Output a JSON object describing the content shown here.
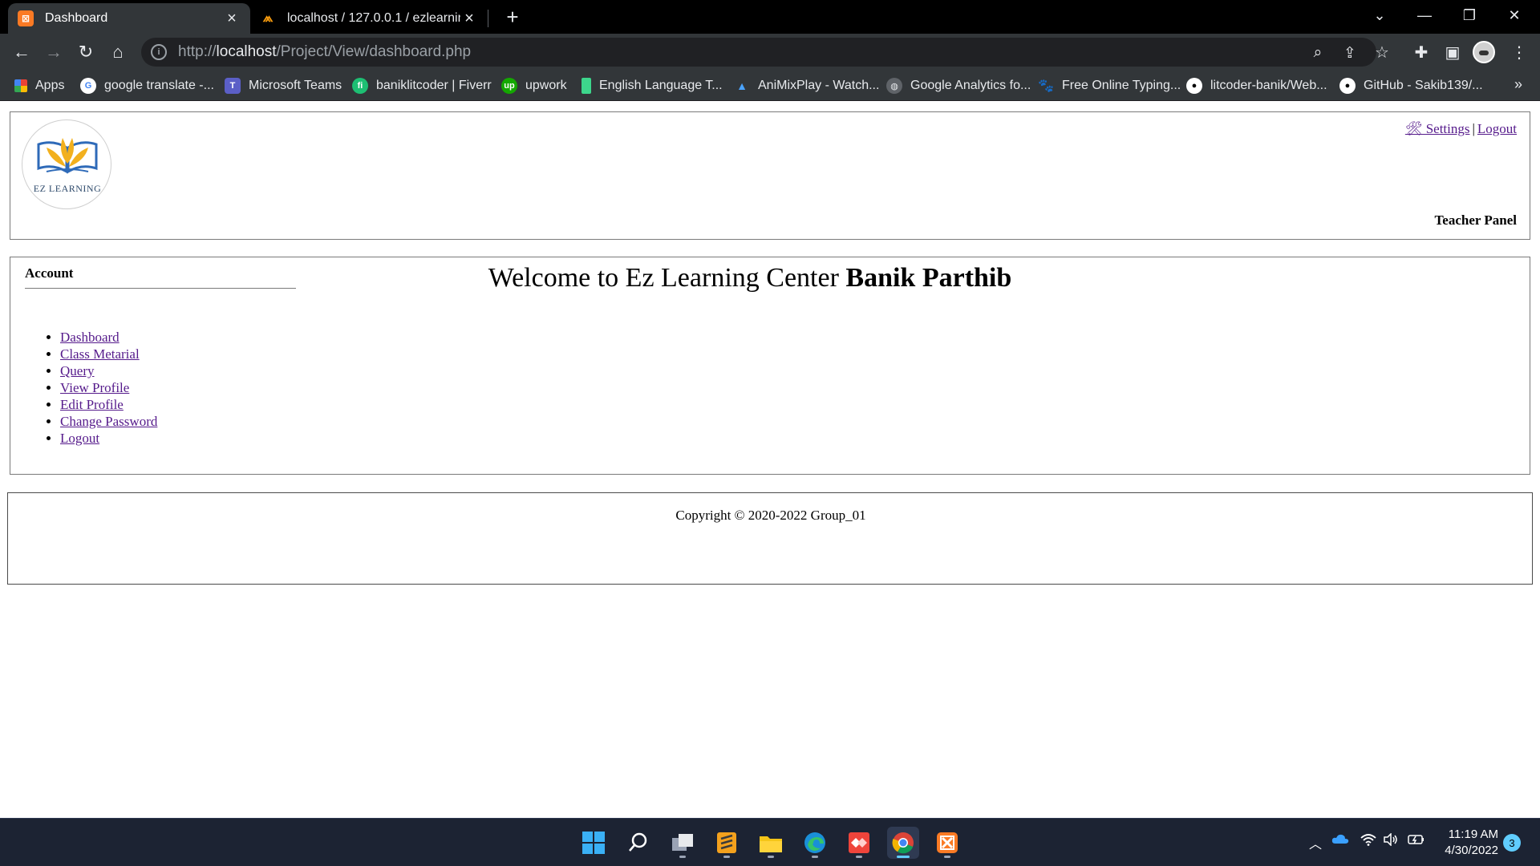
{
  "browser": {
    "tabs": [
      {
        "title": "Dashboard",
        "active": true,
        "icon": "xampp-icon"
      },
      {
        "title": "localhost / 127.0.0.1 / ezlearning",
        "active": false,
        "icon": "phpmyadmin-icon"
      }
    ],
    "url_scheme": "http://",
    "url_host": "localhost",
    "url_path": "/Project/View/dashboard.php",
    "bookmarks": [
      {
        "label": "Apps",
        "icon": "apps-grid-icon"
      },
      {
        "label": "google translate -...",
        "icon": "google-icon"
      },
      {
        "label": "Microsoft Teams",
        "icon": "teams-icon"
      },
      {
        "label": "baniklitcoder | Fiverr",
        "icon": "fiverr-icon"
      },
      {
        "label": "upwork",
        "icon": "upwork-icon"
      },
      {
        "label": "English Language T...",
        "icon": "bookmark-green-icon"
      },
      {
        "label": "AniMixPlay - Watch...",
        "icon": "animixplay-icon"
      },
      {
        "label": "Google Analytics fo...",
        "icon": "globe-icon"
      },
      {
        "label": "Free Online Typing...",
        "icon": "paw-icon"
      },
      {
        "label": "litcoder-banik/Web...",
        "icon": "github-icon"
      },
      {
        "label": "GitHub - Sakib139/...",
        "icon": "github-icon"
      }
    ]
  },
  "page": {
    "logo_text": "EZ LEARNING",
    "top_links": {
      "settings": "🛠 Settings",
      "separator": "|",
      "logout": "Logout"
    },
    "panel_label": "Teacher Panel",
    "account_title": "Account",
    "menu": [
      "Dashboard",
      "Class Metarial",
      "Query",
      "View Profile",
      "Edit Profile",
      "Change Password",
      "Logout"
    ],
    "welcome_prefix": "Welcome to Ez Learning Center",
    "welcome_name": "Banik Parthib",
    "copyright": "Copyright © 2020-2022 Group_01"
  },
  "taskbar": {
    "apps": [
      "windows-start-icon",
      "search-icon",
      "task-view-icon",
      "sublime-text-icon",
      "file-explorer-icon",
      "edge-icon",
      "anydesk-icon",
      "chrome-icon",
      "xampp-icon"
    ],
    "time": "11:19 AM",
    "date": "4/30/2022",
    "notifications": "3"
  },
  "colors": {
    "link": "#551a8b",
    "chrome_dark": "#323639",
    "taskbar": "#1c2333"
  }
}
